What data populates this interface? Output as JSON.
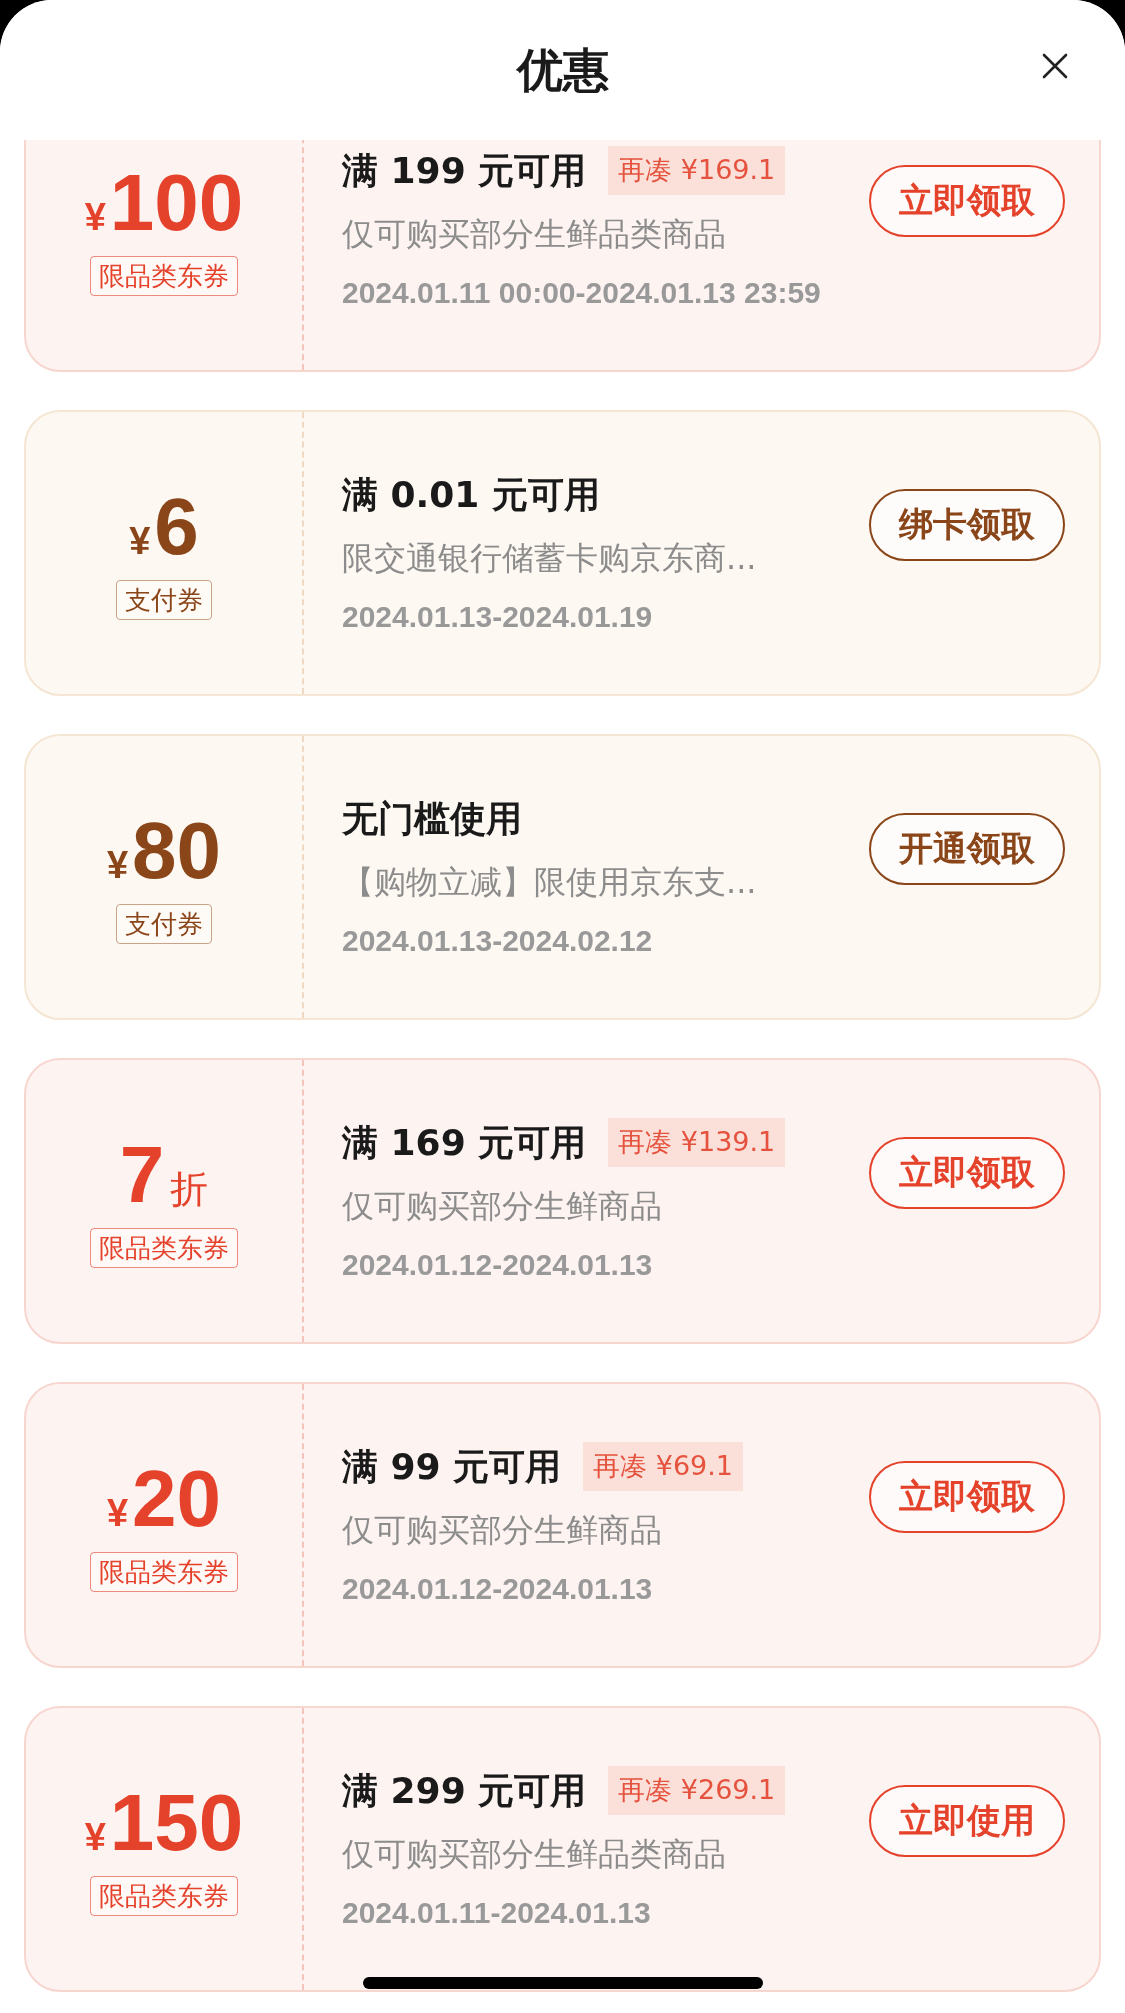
{
  "header": {
    "title": "优惠"
  },
  "coupons": [
    {
      "kind": "category",
      "currency": "¥",
      "amount": "100",
      "tag": "限品类东券",
      "condition": "满 199 元可用",
      "topup": "再凑 ¥169.1",
      "description": "仅可购买部分生鲜品类商品",
      "validity": "2024.01.11 00:00-2024.01.13 23:59",
      "button": "立即领取"
    },
    {
      "kind": "payment",
      "currency": "¥",
      "amount": "6",
      "tag": "支付券",
      "condition": "满 0.01 元可用",
      "description": "限交通银行储蓄卡购京东商...",
      "validity": "2024.01.13-2024.01.19",
      "button": "绑卡领取"
    },
    {
      "kind": "payment",
      "currency": "¥",
      "amount": "80",
      "tag": "支付券",
      "condition": "无门槛使用",
      "description": "【购物立减】限使用京东支...",
      "validity": "2024.01.13-2024.02.12",
      "button": "开通领取"
    },
    {
      "kind": "category",
      "amount": "7",
      "unit": "折",
      "tag": "限品类东券",
      "condition": "满 169 元可用",
      "topup": "再凑 ¥139.1",
      "description": "仅可购买部分生鲜商品",
      "validity": "2024.01.12-2024.01.13",
      "button": "立即领取"
    },
    {
      "kind": "category",
      "currency": "¥",
      "amount": "20",
      "tag": "限品类东券",
      "condition": "满 99 元可用",
      "topup": "再凑 ¥69.1",
      "description": "仅可购买部分生鲜商品",
      "validity": "2024.01.12-2024.01.13",
      "button": "立即领取"
    },
    {
      "kind": "category",
      "currency": "¥",
      "amount": "150",
      "tag": "限品类东券",
      "condition": "满 299 元可用",
      "topup": "再凑 ¥269.1",
      "description": "仅可购买部分生鲜品类商品",
      "validity": "2024.01.11-2024.01.13",
      "button": "立即使用"
    }
  ]
}
